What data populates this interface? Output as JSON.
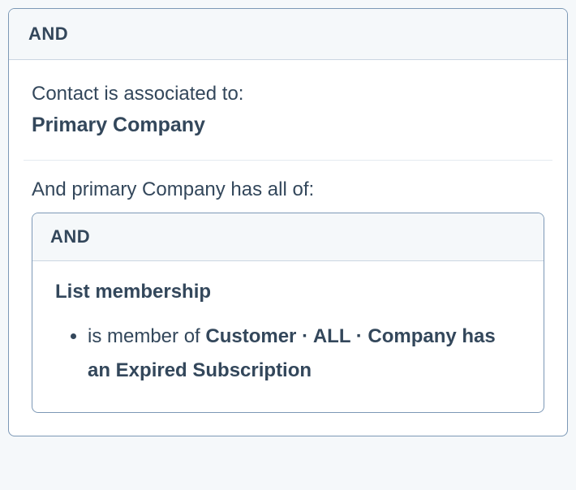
{
  "outer": {
    "operator": "AND",
    "association_label": "Contact is associated to:",
    "association_value": "Primary Company",
    "sub_condition_label": "And primary Company has all of:"
  },
  "inner": {
    "operator": "AND",
    "filter_title": "List membership",
    "rule_prefix": "is member of ",
    "rule_value": "Customer · ALL · Company has an Expired Subscription"
  }
}
